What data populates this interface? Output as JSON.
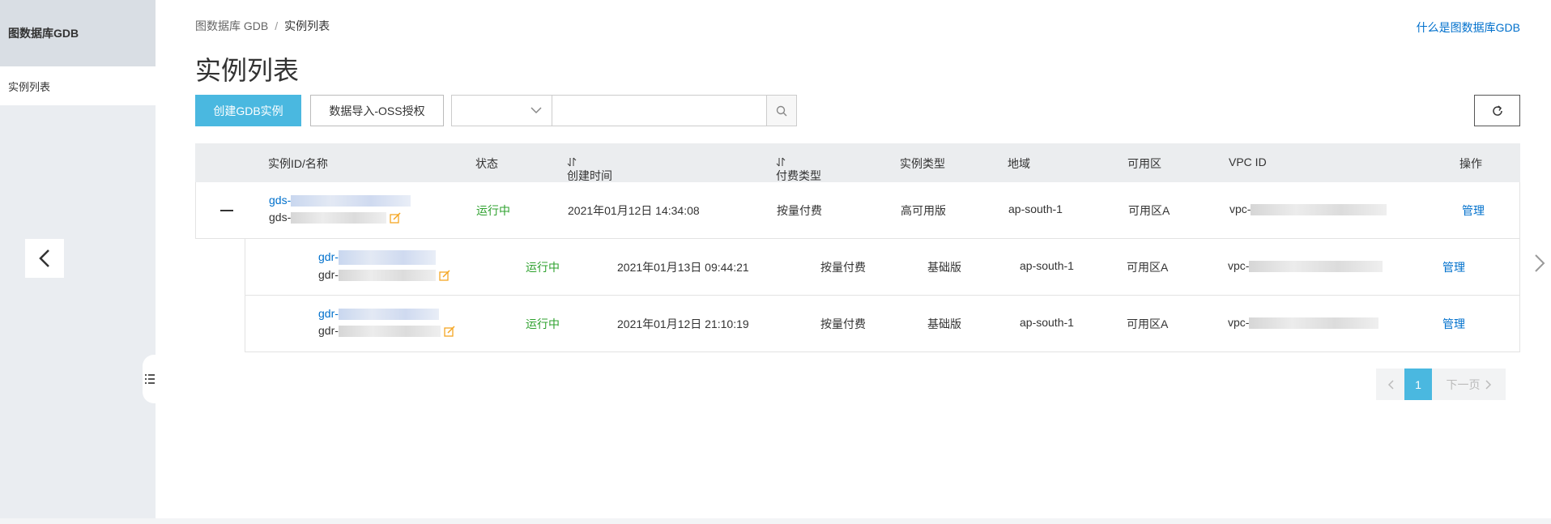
{
  "sidebar": {
    "title": "图数据库GDB",
    "items": [
      {
        "label": "实例列表"
      }
    ]
  },
  "breadcrumb": {
    "root": "图数据库 GDB",
    "separator": "/",
    "current": "实例列表"
  },
  "help_link": "什么是图数据库GDB",
  "page_title": "实例列表",
  "toolbar": {
    "create_label": "创建GDB实例",
    "import_label": "数据导入-OSS授权",
    "select_value": "",
    "search_value": ""
  },
  "table": {
    "headers": {
      "id": "实例ID/名称",
      "status": "状态",
      "created": "创建时间",
      "pay": "付费类型",
      "type": "实例类型",
      "region": "地域",
      "zone": "可用区",
      "vpc": "VPC ID",
      "action": "操作"
    },
    "parent": {
      "id_prefix": "gds-",
      "name_prefix": "gds-",
      "status": "运行中",
      "created": "2021年01月12日 14:34:08",
      "pay": "按量付费",
      "type": "高可用版",
      "region": "ap-south-1",
      "zone": "可用区A",
      "vpc_prefix": "vpc-",
      "action": "管理"
    },
    "children": [
      {
        "id_prefix": "gdr-",
        "name_prefix": "gdr-",
        "status": "运行中",
        "created": "2021年01月13日 09:44:21",
        "pay": "按量付费",
        "type": "基础版",
        "region": "ap-south-1",
        "zone": "可用区A",
        "vpc_prefix": "vpc-",
        "action": "管理"
      },
      {
        "id_prefix": "gdr-",
        "name_prefix": "gdr-",
        "status": "运行中",
        "created": "2021年01月12日 21:10:19",
        "pay": "按量付费",
        "type": "基础版",
        "region": "ap-south-1",
        "zone": "可用区A",
        "vpc_prefix": "vpc-",
        "action": "管理"
      }
    ]
  },
  "pagination": {
    "current": "1",
    "next_label": "下一页"
  },
  "colors": {
    "primary": "#4ab8e0",
    "link": "#0070cc",
    "running": "#2ea12e"
  }
}
